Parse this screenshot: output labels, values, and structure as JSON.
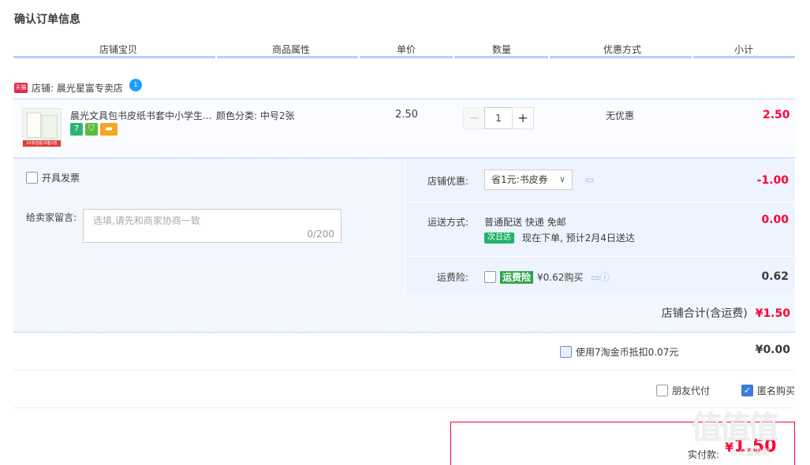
{
  "page": {
    "title": "确认订单信息"
  },
  "columns": [
    "店铺宝贝",
    "商品属性",
    "单价",
    "数量",
    "优惠方式",
    "小计"
  ],
  "shop": {
    "tmall_badge": "天猫",
    "label": "店铺: 晨光星富专卖店",
    "chat_badge": "1"
  },
  "item": {
    "title": "晨光文具包书皮纸书套中小学生...",
    "thumb_band": "10本自粘书套2张",
    "badges": [
      "7",
      "⛉",
      "▬"
    ],
    "attribute": "颜色分类: 中号2张",
    "price": "2.50",
    "quantity": "1",
    "minus": "−",
    "plus": "+",
    "discount": "无优惠",
    "subtotal": "2.50"
  },
  "invoice": {
    "label": "开具发票",
    "checked": false
  },
  "message": {
    "label": "给卖家留言:",
    "placeholder": "选填,请先和商家协商一致",
    "count": "0/200"
  },
  "shop_discount": {
    "label": "店铺优惠:",
    "selected": "省1元:书皮券",
    "amount": "-1.00"
  },
  "shipping": {
    "label": "运送方式:",
    "method": "普通配送 快递 免邮",
    "next_day_badge": "次日达",
    "eta": "现在下单, 预计2月4日送达",
    "amount": "0.00"
  },
  "insurance": {
    "label": "运费险:",
    "badge": "运费险",
    "text": "¥0.62购买",
    "amount": "0.62"
  },
  "shop_total": {
    "label": "店铺合计(含运费)",
    "amount": "¥1.50"
  },
  "coins": {
    "label": "使用7淘金币抵扣0.07元",
    "amount": "¥0.00"
  },
  "options": {
    "friend_pay": "朋友代付",
    "anonymous": "匿名购买",
    "anonymous_checked": true
  },
  "payment": {
    "label": "实付款:",
    "currency": "¥",
    "amount": "1.50"
  },
  "watermark": {
    "text": "值值值",
    "sub": "什么值得买"
  },
  "colors": {
    "accent": "#ff0036",
    "header_line": "#b2d1ff",
    "panel_bg": "#f2f7ff"
  }
}
